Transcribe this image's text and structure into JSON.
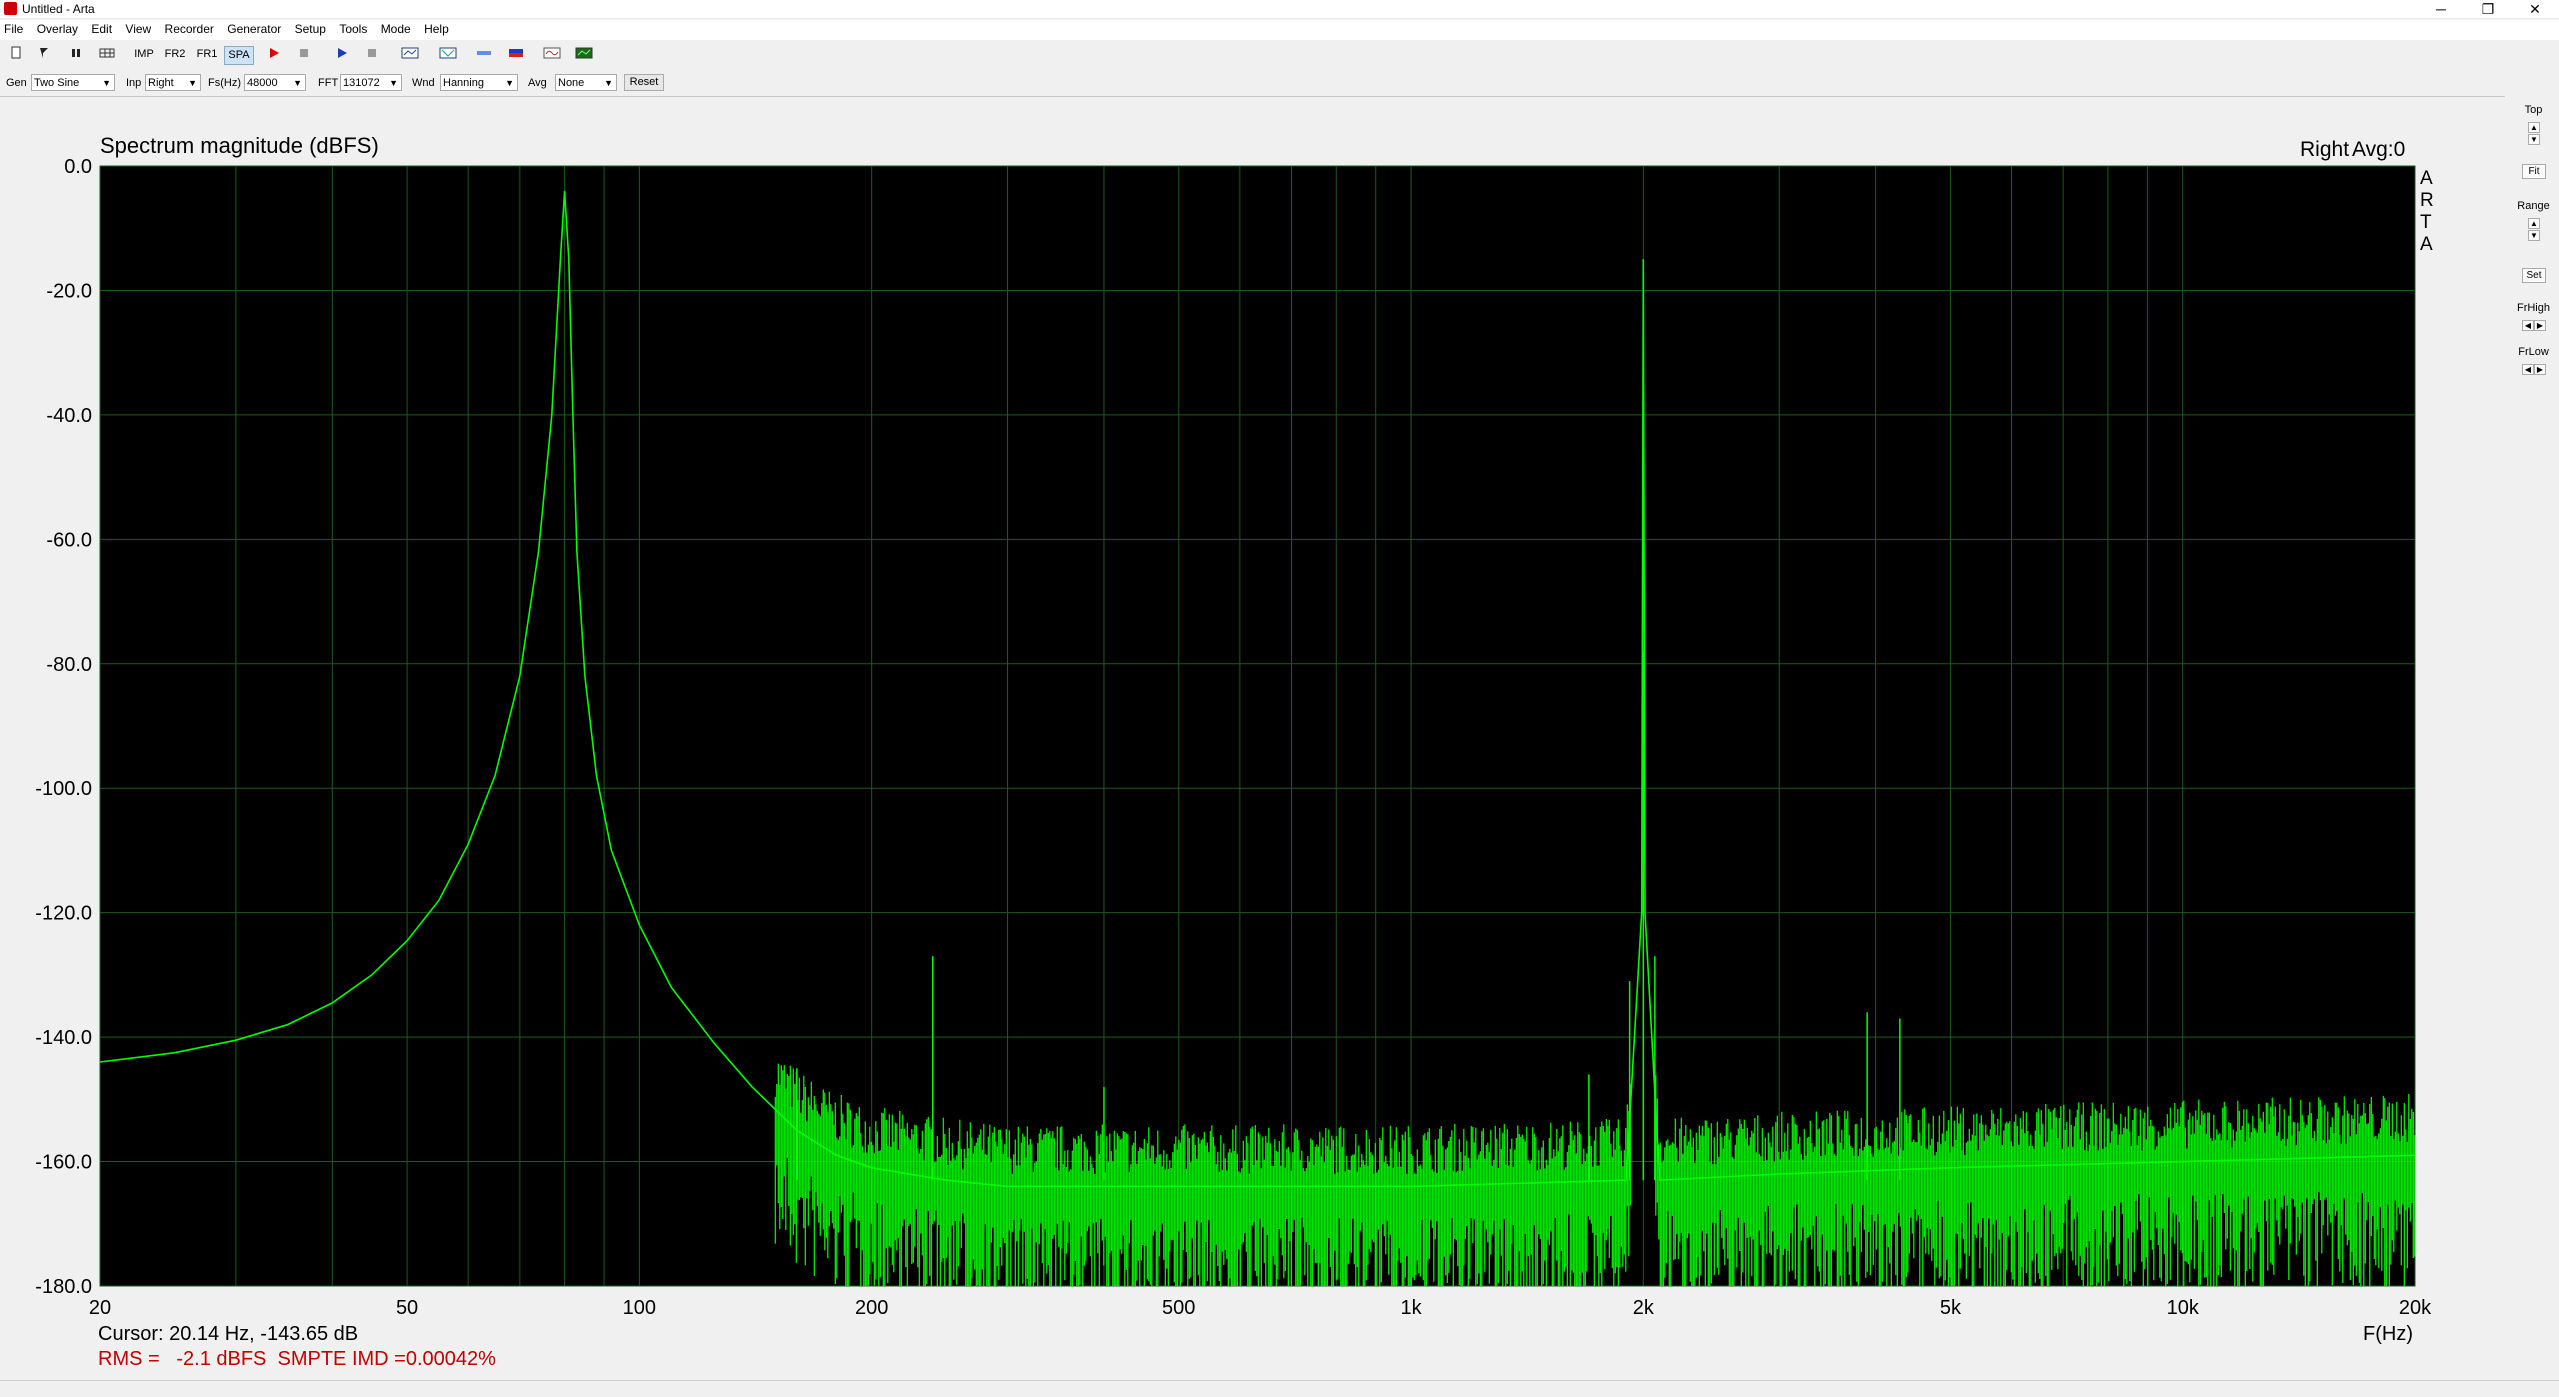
{
  "window": {
    "title": "Untitled - Arta",
    "minimize": "─",
    "maximize": "❐",
    "close": "✕"
  },
  "menu": [
    "File",
    "Overlay",
    "Edit",
    "View",
    "Recorder",
    "Generator",
    "Setup",
    "Tools",
    "Mode",
    "Help"
  ],
  "toolbar": {
    "imp": "IMP",
    "fr2": "FR2",
    "fr1": "FR1",
    "spa": "SPA"
  },
  "controls": {
    "gen_label": "Gen",
    "gen_value": "Two Sine",
    "inp_label": "Inp",
    "inp_value": "Right",
    "fs_label": "Fs(Hz)",
    "fs_value": "48000",
    "fft_label": "FFT",
    "fft_value": "131072",
    "wnd_label": "Wnd",
    "wnd_value": "Hanning",
    "avg_label": "Avg",
    "avg_value": "None",
    "reset": "Reset"
  },
  "right_panel": {
    "top": "Top",
    "fit": "Fit",
    "range": "Range",
    "set": "Set",
    "frhigh": "FrHigh",
    "frlow": "FrLow"
  },
  "graph": {
    "title": "Spectrum magnitude (dBFS)",
    "channel": "Right",
    "avg": "Avg:0",
    "brand": [
      "A",
      "R",
      "T",
      "A"
    ],
    "cursor": "Cursor: 20.14 Hz, -143.65 dB",
    "rms": "RMS =   -2.1 dBFS  SMPTE IMD =0.00042%",
    "xlabel": "F(Hz)"
  },
  "chart_data": {
    "type": "line",
    "title": "Spectrum magnitude (dBFS)",
    "xlabel": "F(Hz)",
    "ylabel": "",
    "x_scale": "log",
    "xlim": [
      20,
      20000
    ],
    "ylim": [
      -180,
      0
    ],
    "x_ticks": [
      20,
      50,
      100,
      200,
      500,
      1000,
      2000,
      5000,
      10000,
      20000
    ],
    "x_tick_labels": [
      "20",
      "50",
      "100",
      "200",
      "500",
      "1k",
      "2k",
      "5k",
      "10k",
      "20k"
    ],
    "y_ticks": [
      0,
      -20,
      -40,
      -60,
      -80,
      -100,
      -120,
      -140,
      -160,
      -180
    ],
    "y_tick_labels": [
      "0.0",
      "-20.0",
      "-40.0",
      "-60.0",
      "-80.0",
      "-100.0",
      "-120.0",
      "-140.0",
      "-160.0",
      "-180.0"
    ],
    "grid": true,
    "line_color": "#00ff00",
    "background": "#000000",
    "grid_color": "#1e5a1e",
    "series": [
      {
        "values_x": [
          20,
          25,
          30,
          35,
          40,
          45,
          50,
          55,
          60,
          65,
          70,
          74,
          77,
          79,
          80,
          81,
          82,
          83,
          85,
          88,
          92,
          100,
          110,
          125,
          140,
          160,
          180,
          200,
          250,
          300,
          500,
          1000,
          1900,
          1990,
          2000,
          2010,
          2100,
          3000,
          5000,
          10000,
          20000
        ],
        "values_y": [
          -144,
          -142.5,
          -140.5,
          -138,
          -134.5,
          -130,
          -124.5,
          -118,
          -109,
          -98,
          -82,
          -62,
          -40,
          -15,
          -4,
          -15,
          -40,
          -62,
          -82,
          -98,
          -110,
          -122,
          -132,
          -141,
          -148,
          -155,
          -159,
          -161,
          -163,
          -164,
          -164,
          -164,
          -163,
          -120,
          -15,
          -120,
          -163,
          -162,
          -161,
          -160,
          -159
        ]
      }
    ],
    "spurs": [
      {
        "x": 240,
        "y": -127
      },
      {
        "x": 160,
        "y": -145
      },
      {
        "x": 1920,
        "y": -131
      },
      {
        "x": 2070,
        "y": -127
      },
      {
        "x": 1700,
        "y": -146
      },
      {
        "x": 3900,
        "y": -136
      },
      {
        "x": 4300,
        "y": -137
      },
      {
        "x": 400,
        "y": -148
      },
      {
        "x": 2000,
        "y": -78
      }
    ]
  }
}
